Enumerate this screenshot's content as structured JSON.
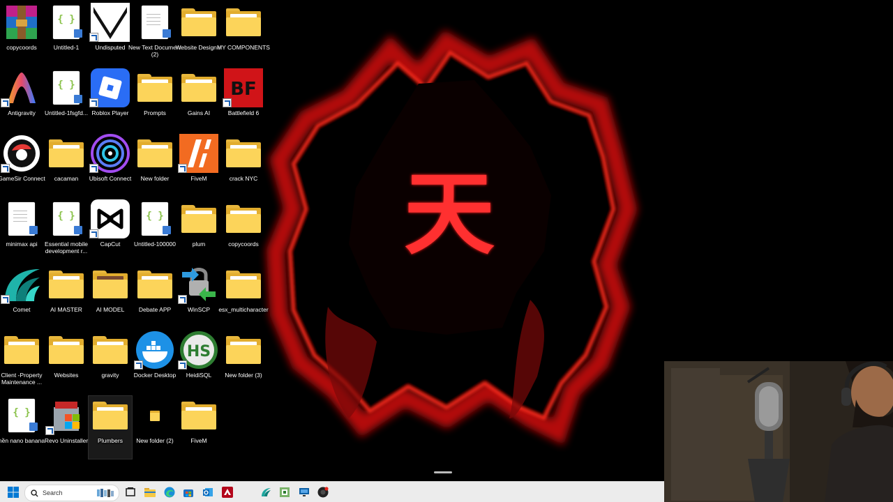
{
  "desktop": {
    "icons": [
      {
        "label": "copycoords",
        "kind": "app-winrar",
        "shortcut": false
      },
      {
        "label": "Untitled-1",
        "kind": "doc-code",
        "shortcut": false
      },
      {
        "label": "Undisputed",
        "kind": "app-undisputed",
        "shortcut": true
      },
      {
        "label": "New Text Document (2)",
        "kind": "doc-text",
        "shortcut": false
      },
      {
        "label": "Website Designer",
        "kind": "folder",
        "shortcut": false
      },
      {
        "label": "MY COMPONENTS",
        "kind": "folder",
        "shortcut": false
      },
      {
        "label": "Antigravity",
        "kind": "app-antigravity",
        "shortcut": true
      },
      {
        "label": "Untitled-1fsgfd...",
        "kind": "doc-code",
        "shortcut": false
      },
      {
        "label": "Roblox Player",
        "kind": "app-roblox",
        "shortcut": true
      },
      {
        "label": "Prompts",
        "kind": "folder",
        "shortcut": false
      },
      {
        "label": "Gains AI",
        "kind": "folder",
        "shortcut": false
      },
      {
        "label": "Battlefield 6",
        "kind": "app-bf",
        "shortcut": true
      },
      {
        "label": "GameSir Connect",
        "kind": "app-gamesir",
        "shortcut": true
      },
      {
        "label": "cacaman",
        "kind": "folder",
        "shortcut": false
      },
      {
        "label": "Ubisoft Connect",
        "kind": "app-ubisoft",
        "shortcut": true
      },
      {
        "label": "New folder",
        "kind": "folder",
        "shortcut": false
      },
      {
        "label": "FiveM",
        "kind": "app-fivem",
        "shortcut": true
      },
      {
        "label": "crack NYC",
        "kind": "folder",
        "shortcut": false
      },
      {
        "label": "minimax api",
        "kind": "doc-text",
        "shortcut": false
      },
      {
        "label": "Essential mobile development r...",
        "kind": "doc-code",
        "shortcut": false
      },
      {
        "label": "CapCut",
        "kind": "app-capcut",
        "shortcut": true
      },
      {
        "label": "Untitled-100000",
        "kind": "doc-code",
        "shortcut": false
      },
      {
        "label": "plum",
        "kind": "folder",
        "shortcut": false
      },
      {
        "label": "copycoords",
        "kind": "folder",
        "shortcut": false
      },
      {
        "label": "Comet",
        "kind": "app-comet",
        "shortcut": true
      },
      {
        "label": "AI MASTER",
        "kind": "folder",
        "shortcut": false
      },
      {
        "label": "AI MODEL",
        "kind": "folder-photo",
        "shortcut": false
      },
      {
        "label": "Debate APP",
        "kind": "folder",
        "shortcut": false
      },
      {
        "label": "WinSCP",
        "kind": "app-winscp",
        "shortcut": true
      },
      {
        "label": "esx_multicharacter",
        "kind": "folder",
        "shortcut": false
      },
      {
        "label": "Client -Property Maintenance ...",
        "kind": "folder",
        "shortcut": false
      },
      {
        "label": "Websites",
        "kind": "folder",
        "shortcut": false
      },
      {
        "label": "gravity",
        "kind": "folder",
        "shortcut": false
      },
      {
        "label": "Docker Desktop",
        "kind": "app-docker",
        "shortcut": true
      },
      {
        "label": "HeidiSQL",
        "kind": "app-heidisql",
        "shortcut": true
      },
      {
        "label": "New folder (3)",
        "kind": "folder",
        "shortcut": false
      },
      {
        "label": "nền nano banana",
        "kind": "doc-code",
        "shortcut": false
      },
      {
        "label": "Revo Uninstaller",
        "kind": "app-revo",
        "shortcut": true
      },
      {
        "label": "Plumbers",
        "kind": "folder",
        "shortcut": false,
        "selected": true
      },
      {
        "label": "New folder (2)",
        "kind": "folder-small",
        "shortcut": false
      },
      {
        "label": "FiveM",
        "kind": "folder",
        "shortcut": false
      }
    ]
  },
  "wallpaper": {
    "kanji": "天",
    "colors": {
      "glow": "#d3100f",
      "kanji": "#ff2020",
      "background": "#000000"
    }
  },
  "taskbar": {
    "search_placeholder": "Search",
    "items": [
      "windows-start-icon",
      "search-icon",
      "task-view-icon",
      "file-explorer-icon",
      "edge-icon",
      "store-icon",
      "outlook-icon",
      "adobe-icon",
      "comet-icon",
      "tool-icon",
      "monitor-icon",
      "chrome-icon"
    ]
  }
}
